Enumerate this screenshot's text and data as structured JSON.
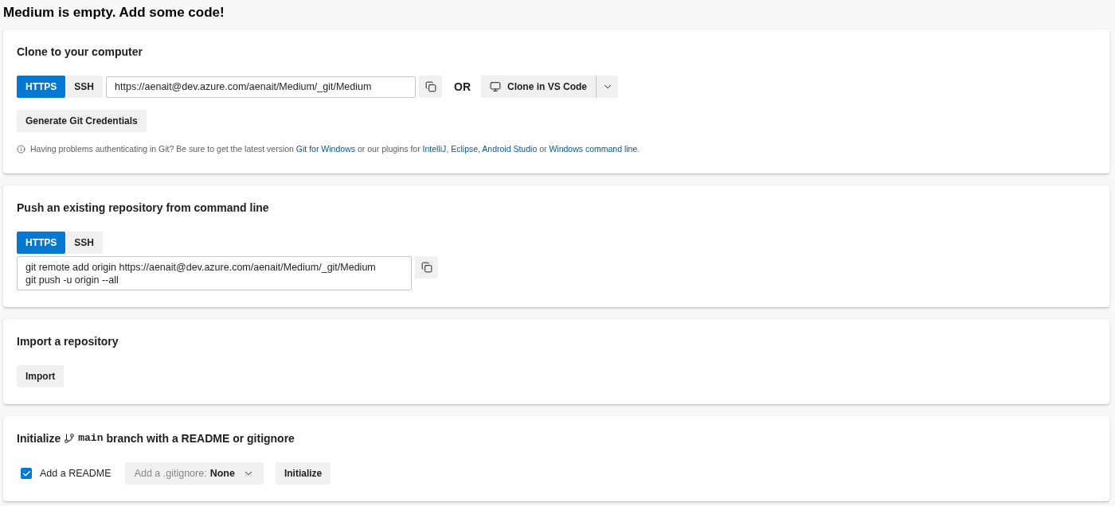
{
  "page_title": "Medium is empty. Add some code!",
  "clone": {
    "title": "Clone to your computer",
    "protocols": [
      {
        "label": "HTTPS",
        "selected": true
      },
      {
        "label": "SSH",
        "selected": false
      }
    ],
    "url": {
      "value": "https://aenait@dev.azure.com/aenait/Medium/_git/Medium"
    },
    "separator": "OR",
    "clone_button": {
      "label": "Clone in VS Code"
    },
    "credentials_button": {
      "label": "Generate Git Credentials"
    },
    "help": [
      {
        "kind": "text",
        "text": "Having problems authenticating in Git? Be sure to get the latest version "
      },
      {
        "kind": "link",
        "text": "Git for Windows"
      },
      {
        "kind": "text",
        "text": " or our plugins for "
      },
      {
        "kind": "link",
        "text": "IntelliJ"
      },
      {
        "kind": "text",
        "text": ", "
      },
      {
        "kind": "link",
        "text": "Eclipse"
      },
      {
        "kind": "text",
        "text": ", "
      },
      {
        "kind": "link",
        "text": "Android Studio"
      },
      {
        "kind": "text",
        "text": " or "
      },
      {
        "kind": "link",
        "text": "Windows command line"
      },
      {
        "kind": "text",
        "text": "."
      }
    ]
  },
  "push": {
    "title": "Push an existing repository from command line",
    "protocols": [
      {
        "label": "HTTPS",
        "selected": true
      },
      {
        "label": "SSH",
        "selected": false
      }
    ],
    "commands": [
      "git remote add origin https://aenait@dev.azure.com/aenait/Medium/_git/Medium",
      "git push -u origin --all"
    ]
  },
  "import": {
    "title": "Import a repository",
    "import_button": {
      "label": "Import"
    }
  },
  "initialize": {
    "title_start": "Initialize",
    "branch": "main",
    "title_end": "branch with a README or gitignore",
    "readme": {
      "label": "Add a README",
      "checked": true
    },
    "gitignore": {
      "label": "Add a .gitignore:",
      "value": "None"
    },
    "initialize_button": {
      "label": "Initialize"
    }
  }
}
